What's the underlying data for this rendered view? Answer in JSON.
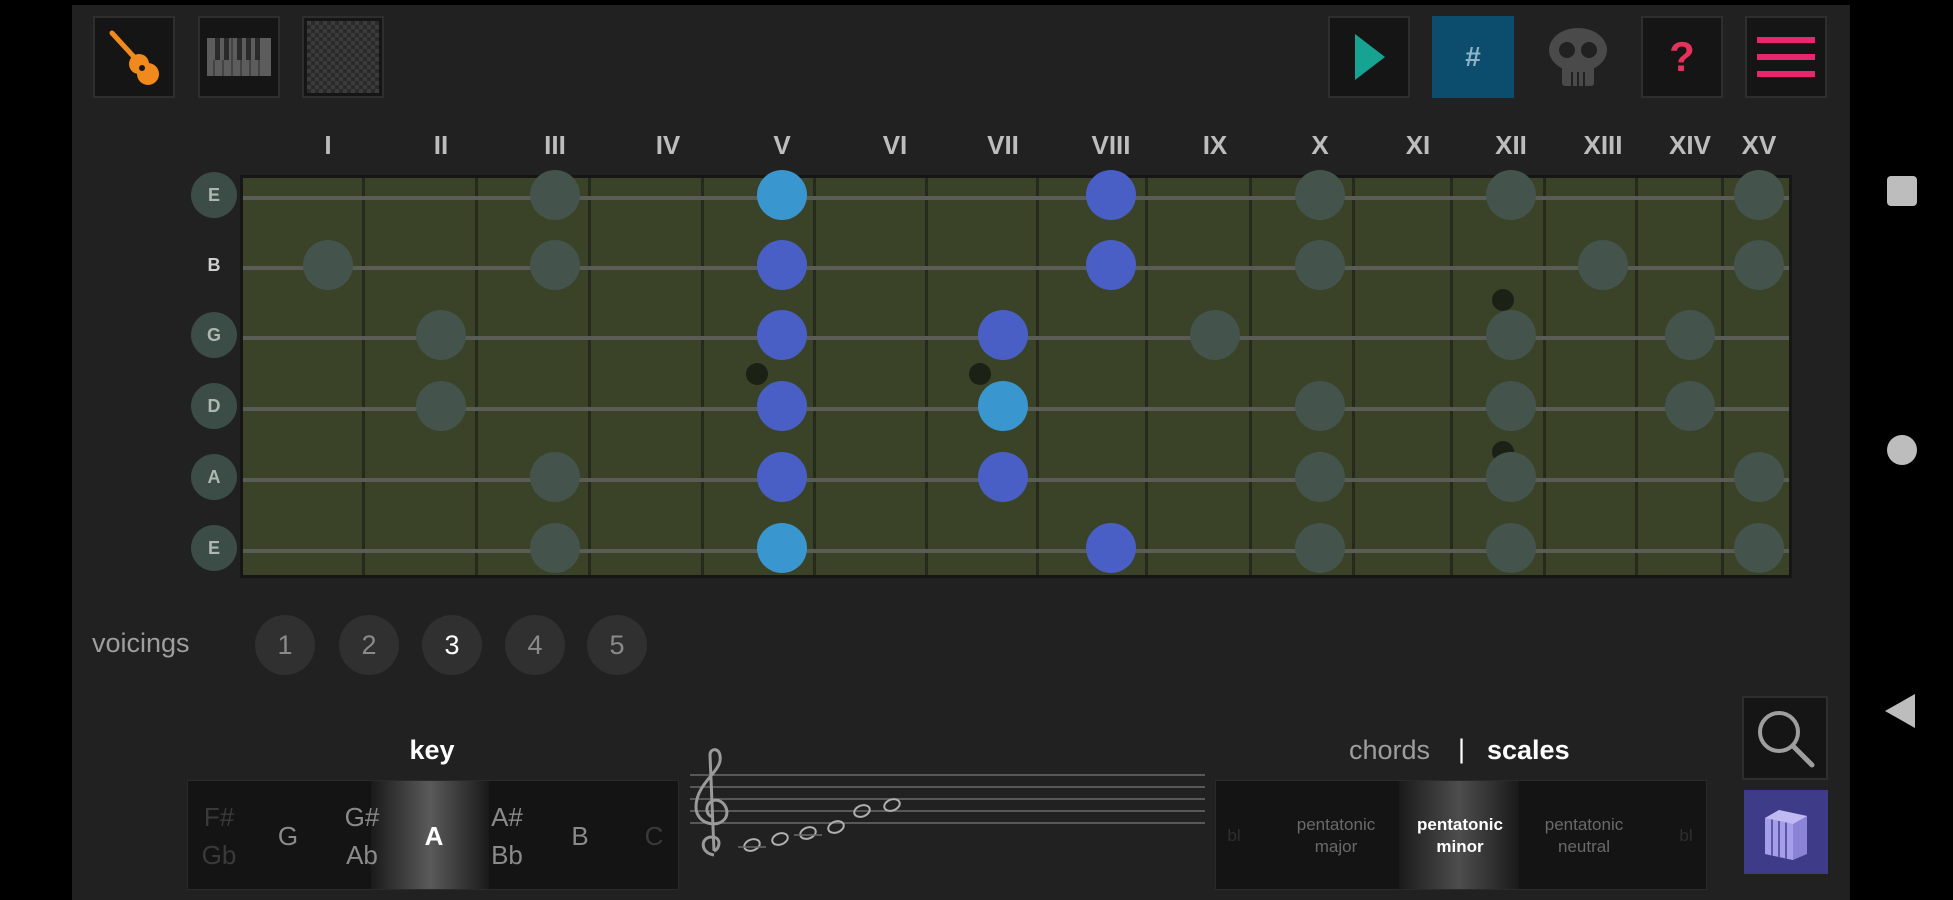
{
  "toolbar": {
    "left": [
      {
        "name": "guitar-instrument-button",
        "icon": "guitar-icon",
        "color": "#f08a1c"
      },
      {
        "name": "piano-instrument-button",
        "icon": "piano-keyboard-icon",
        "color": "#595959"
      },
      {
        "name": "grid-instrument-button",
        "icon": "checker-grid-icon",
        "color": "#3a3a3a"
      }
    ],
    "right": [
      {
        "name": "play-button",
        "icon": "play-icon",
        "color": "#17a392"
      },
      {
        "name": "sharp-toggle-button",
        "label": "#",
        "icon": "sharp-icon",
        "color": "#0c4d6e"
      },
      {
        "name": "skull-button",
        "icon": "skull-icon",
        "color": "#4a4a4a"
      },
      {
        "name": "help-button",
        "icon": "question-icon",
        "label": "?",
        "color": "#e6315b"
      },
      {
        "name": "menu-button",
        "icon": "hamburger-menu-icon",
        "color": "#e8266d"
      }
    ]
  },
  "fret_labels": [
    "I",
    "II",
    "III",
    "IV",
    "V",
    "VI",
    "VII",
    "VIII",
    "IX",
    "X",
    "XI",
    "XII",
    "XIII",
    "XIV",
    "XV"
  ],
  "strings": [
    "E",
    "B",
    "G",
    "D",
    "A",
    "E"
  ],
  "fretboard": {
    "highlighted_position": "V",
    "notes": [
      {
        "string": 1,
        "fret": "III",
        "state": "ghost"
      },
      {
        "string": 1,
        "fret": "V",
        "state": "root"
      },
      {
        "string": 1,
        "fret": "VIII",
        "state": "active"
      },
      {
        "string": 1,
        "fret": "X",
        "state": "ghost"
      },
      {
        "string": 1,
        "fret": "XII",
        "state": "ghost"
      },
      {
        "string": 1,
        "fret": "XV",
        "state": "ghost"
      },
      {
        "string": 2,
        "fret": "I",
        "state": "ghost"
      },
      {
        "string": 2,
        "fret": "III",
        "state": "ghost"
      },
      {
        "string": 2,
        "fret": "V",
        "state": "active"
      },
      {
        "string": 2,
        "fret": "VIII",
        "state": "active"
      },
      {
        "string": 2,
        "fret": "X",
        "state": "ghost"
      },
      {
        "string": 2,
        "fret": "XIII",
        "state": "ghost"
      },
      {
        "string": 2,
        "fret": "XV",
        "state": "ghost"
      },
      {
        "string": 3,
        "fret": "II",
        "state": "ghost"
      },
      {
        "string": 3,
        "fret": "V",
        "state": "active"
      },
      {
        "string": 3,
        "fret": "VII",
        "state": "active"
      },
      {
        "string": 3,
        "fret": "IX",
        "state": "ghost"
      },
      {
        "string": 3,
        "fret": "XII",
        "state": "ghost"
      },
      {
        "string": 3,
        "fret": "XIV",
        "state": "ghost"
      },
      {
        "string": 4,
        "fret": "II",
        "state": "ghost"
      },
      {
        "string": 4,
        "fret": "V",
        "state": "active"
      },
      {
        "string": 4,
        "fret": "VII",
        "state": "root"
      },
      {
        "string": 4,
        "fret": "X",
        "state": "ghost"
      },
      {
        "string": 4,
        "fret": "XII",
        "state": "ghost"
      },
      {
        "string": 4,
        "fret": "XIV",
        "state": "ghost"
      },
      {
        "string": 5,
        "fret": "III",
        "state": "ghost"
      },
      {
        "string": 5,
        "fret": "V",
        "state": "active"
      },
      {
        "string": 5,
        "fret": "VII",
        "state": "active"
      },
      {
        "string": 5,
        "fret": "X",
        "state": "ghost"
      },
      {
        "string": 5,
        "fret": "XII",
        "state": "ghost"
      },
      {
        "string": 5,
        "fret": "XV",
        "state": "ghost"
      },
      {
        "string": 6,
        "fret": "III",
        "state": "ghost"
      },
      {
        "string": 6,
        "fret": "V",
        "state": "root"
      },
      {
        "string": 6,
        "fret": "VIII",
        "state": "active"
      },
      {
        "string": 6,
        "fret": "X",
        "state": "ghost"
      },
      {
        "string": 6,
        "fret": "XII",
        "state": "ghost"
      },
      {
        "string": 6,
        "fret": "XV",
        "state": "ghost"
      }
    ]
  },
  "voicings": {
    "label": "voicings",
    "options": [
      "1",
      "2",
      "3",
      "4",
      "5"
    ],
    "selected": "3"
  },
  "key_picker": {
    "title": "key",
    "items": [
      {
        "top": "F#",
        "bottom": "Gb",
        "state": "faint"
      },
      {
        "top": "G",
        "bottom": "",
        "state": "normal"
      },
      {
        "top": "G#",
        "bottom": "Ab",
        "state": "normal"
      },
      {
        "top": "A",
        "bottom": "",
        "state": "selected"
      },
      {
        "top": "A#",
        "bottom": "Bb",
        "state": "normal"
      },
      {
        "top": "B",
        "bottom": "",
        "state": "normal"
      },
      {
        "top": "C",
        "bottom": "",
        "state": "faint"
      }
    ]
  },
  "staff": {
    "clef": "treble-clef-icon",
    "note_count": 6
  },
  "mode_tabs": {
    "chords": "chords",
    "separator": "|",
    "scales": "scales",
    "selected": "scales"
  },
  "scale_picker": {
    "items": [
      {
        "label": "bl",
        "state": "faint"
      },
      {
        "label": "pentatonic major",
        "state": "normal"
      },
      {
        "label": "pentatonic minor",
        "state": "selected"
      },
      {
        "label": "pentatonic neutral",
        "state": "normal"
      },
      {
        "label": "bl",
        "state": "faint"
      }
    ]
  },
  "side_buttons": [
    {
      "name": "search-button",
      "icon": "search-icon"
    },
    {
      "name": "library-button",
      "icon": "stacked-cards-icon",
      "color": "#3e3b88"
    }
  ]
}
